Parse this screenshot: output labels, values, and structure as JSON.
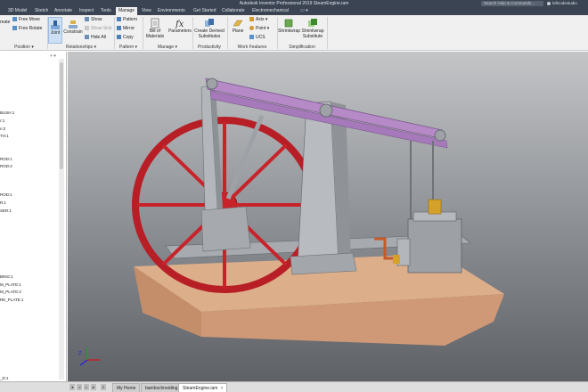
{
  "titlebar": {
    "app_title": "Autodesk Inventor Professional 2019    SteamEngine.iam",
    "search_placeholder": "Search Help & Commands...",
    "user_name": "loftcodestudio"
  },
  "ribbon_tabs": [
    "3D Model",
    "Sketch",
    "Annotate",
    "Inspect",
    "Tools",
    "Manage",
    "View",
    "Environments",
    "Get Started",
    "Collaborate",
    "Electromechanical"
  ],
  "ribbon_active_tab": "Manage",
  "ribbon": {
    "position": {
      "create_label": "reate",
      "free_move": "Free Move",
      "free_rotate": "Free Rotate",
      "panel_label": "Position ▾"
    },
    "relationships": {
      "joint": "Joint",
      "constrain": "Constrain",
      "show": "Show",
      "show_sick": "Show Sick",
      "hide_all": "Hide All",
      "panel_label": "Relationships ▾"
    },
    "pattern": {
      "pattern": "Pattern",
      "mirror": "Mirror",
      "copy": "Copy",
      "panel_label": "Pattern ▾"
    },
    "manage": {
      "bill_of_materials": "Bill of Materials",
      "parameters": "Parameters",
      "panel_label": "Manage ▾"
    },
    "productivity": {
      "create_derived": "Create Derived Substitutes",
      "panel_label": "Productivity"
    },
    "work_features": {
      "plane": "Plane",
      "axis": "Axis ▾",
      "point": "Point ▾",
      "ucs": "UCS",
      "panel_label": "Work Features"
    },
    "simplification": {
      "shrinkwrap": "Shrinkwrap",
      "shrinkwrap_substitute": "Shrinkwrap Substitute",
      "panel_label": "Simplification"
    }
  },
  "browser": {
    "nodes": [
      "BUSH:1",
      "r:1",
      "n:2",
      "TH:1",
      "ROD:1",
      "ROD:2",
      "ROD:1",
      "R:1",
      "SER:1",
      "BING:1",
      "M_PLATE:1",
      "M_PLATE:2",
      "RE_PLATE:1"
    ]
  },
  "doctabs": {
    "my_home": "My Home",
    "beam": "bambschneiding",
    "active": "SteamEngine.iam",
    "close": "×",
    "bottom_nodes": [
      "_D:1",
      "_PLATE:1"
    ]
  },
  "viewport": {
    "colors": {
      "flywheel": "#c8232a",
      "beam": "#b58ac6",
      "base": "#d59e7c",
      "steel": "#a9adb2",
      "brass": "#d4a12a"
    }
  }
}
